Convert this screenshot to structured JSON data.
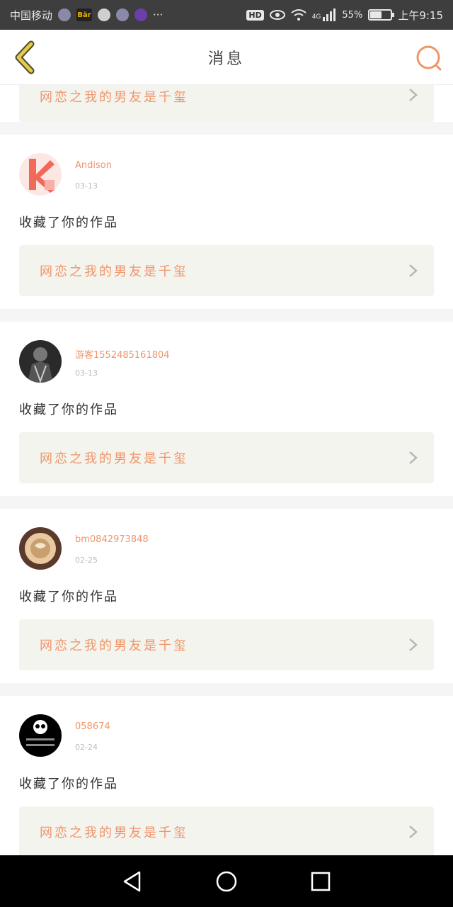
{
  "status_bar": {
    "carrier": "中国移动",
    "more": "···",
    "hd": "HD",
    "network": "4G",
    "battery_percent": "55%",
    "battery_level": 0.55,
    "time": "上午9:15",
    "app_badge": "Bär"
  },
  "nav": {
    "title": "消息",
    "accent": "#f0956a",
    "back_icon": "chevron-left-icon",
    "search_icon": "search-icon"
  },
  "top_partial": {
    "work_title": "网恋之我的男友是千玺"
  },
  "notifications": [
    {
      "username": "Andison",
      "date": "03-13",
      "action": "收藏了你的作品",
      "work_title": "网恋之我的男友是千玺"
    },
    {
      "username": "游客1552485161804",
      "date": "03-13",
      "action": "收藏了你的作品",
      "work_title": "网恋之我的男友是千玺"
    },
    {
      "username": "bm0842973848",
      "date": "02-25",
      "action": "收藏了你的作品",
      "work_title": "网恋之我的男友是千玺"
    },
    {
      "username": "058674",
      "date": "02-24",
      "action": "收藏了你的作品",
      "work_title": "网恋之我的男友是千玺"
    }
  ]
}
